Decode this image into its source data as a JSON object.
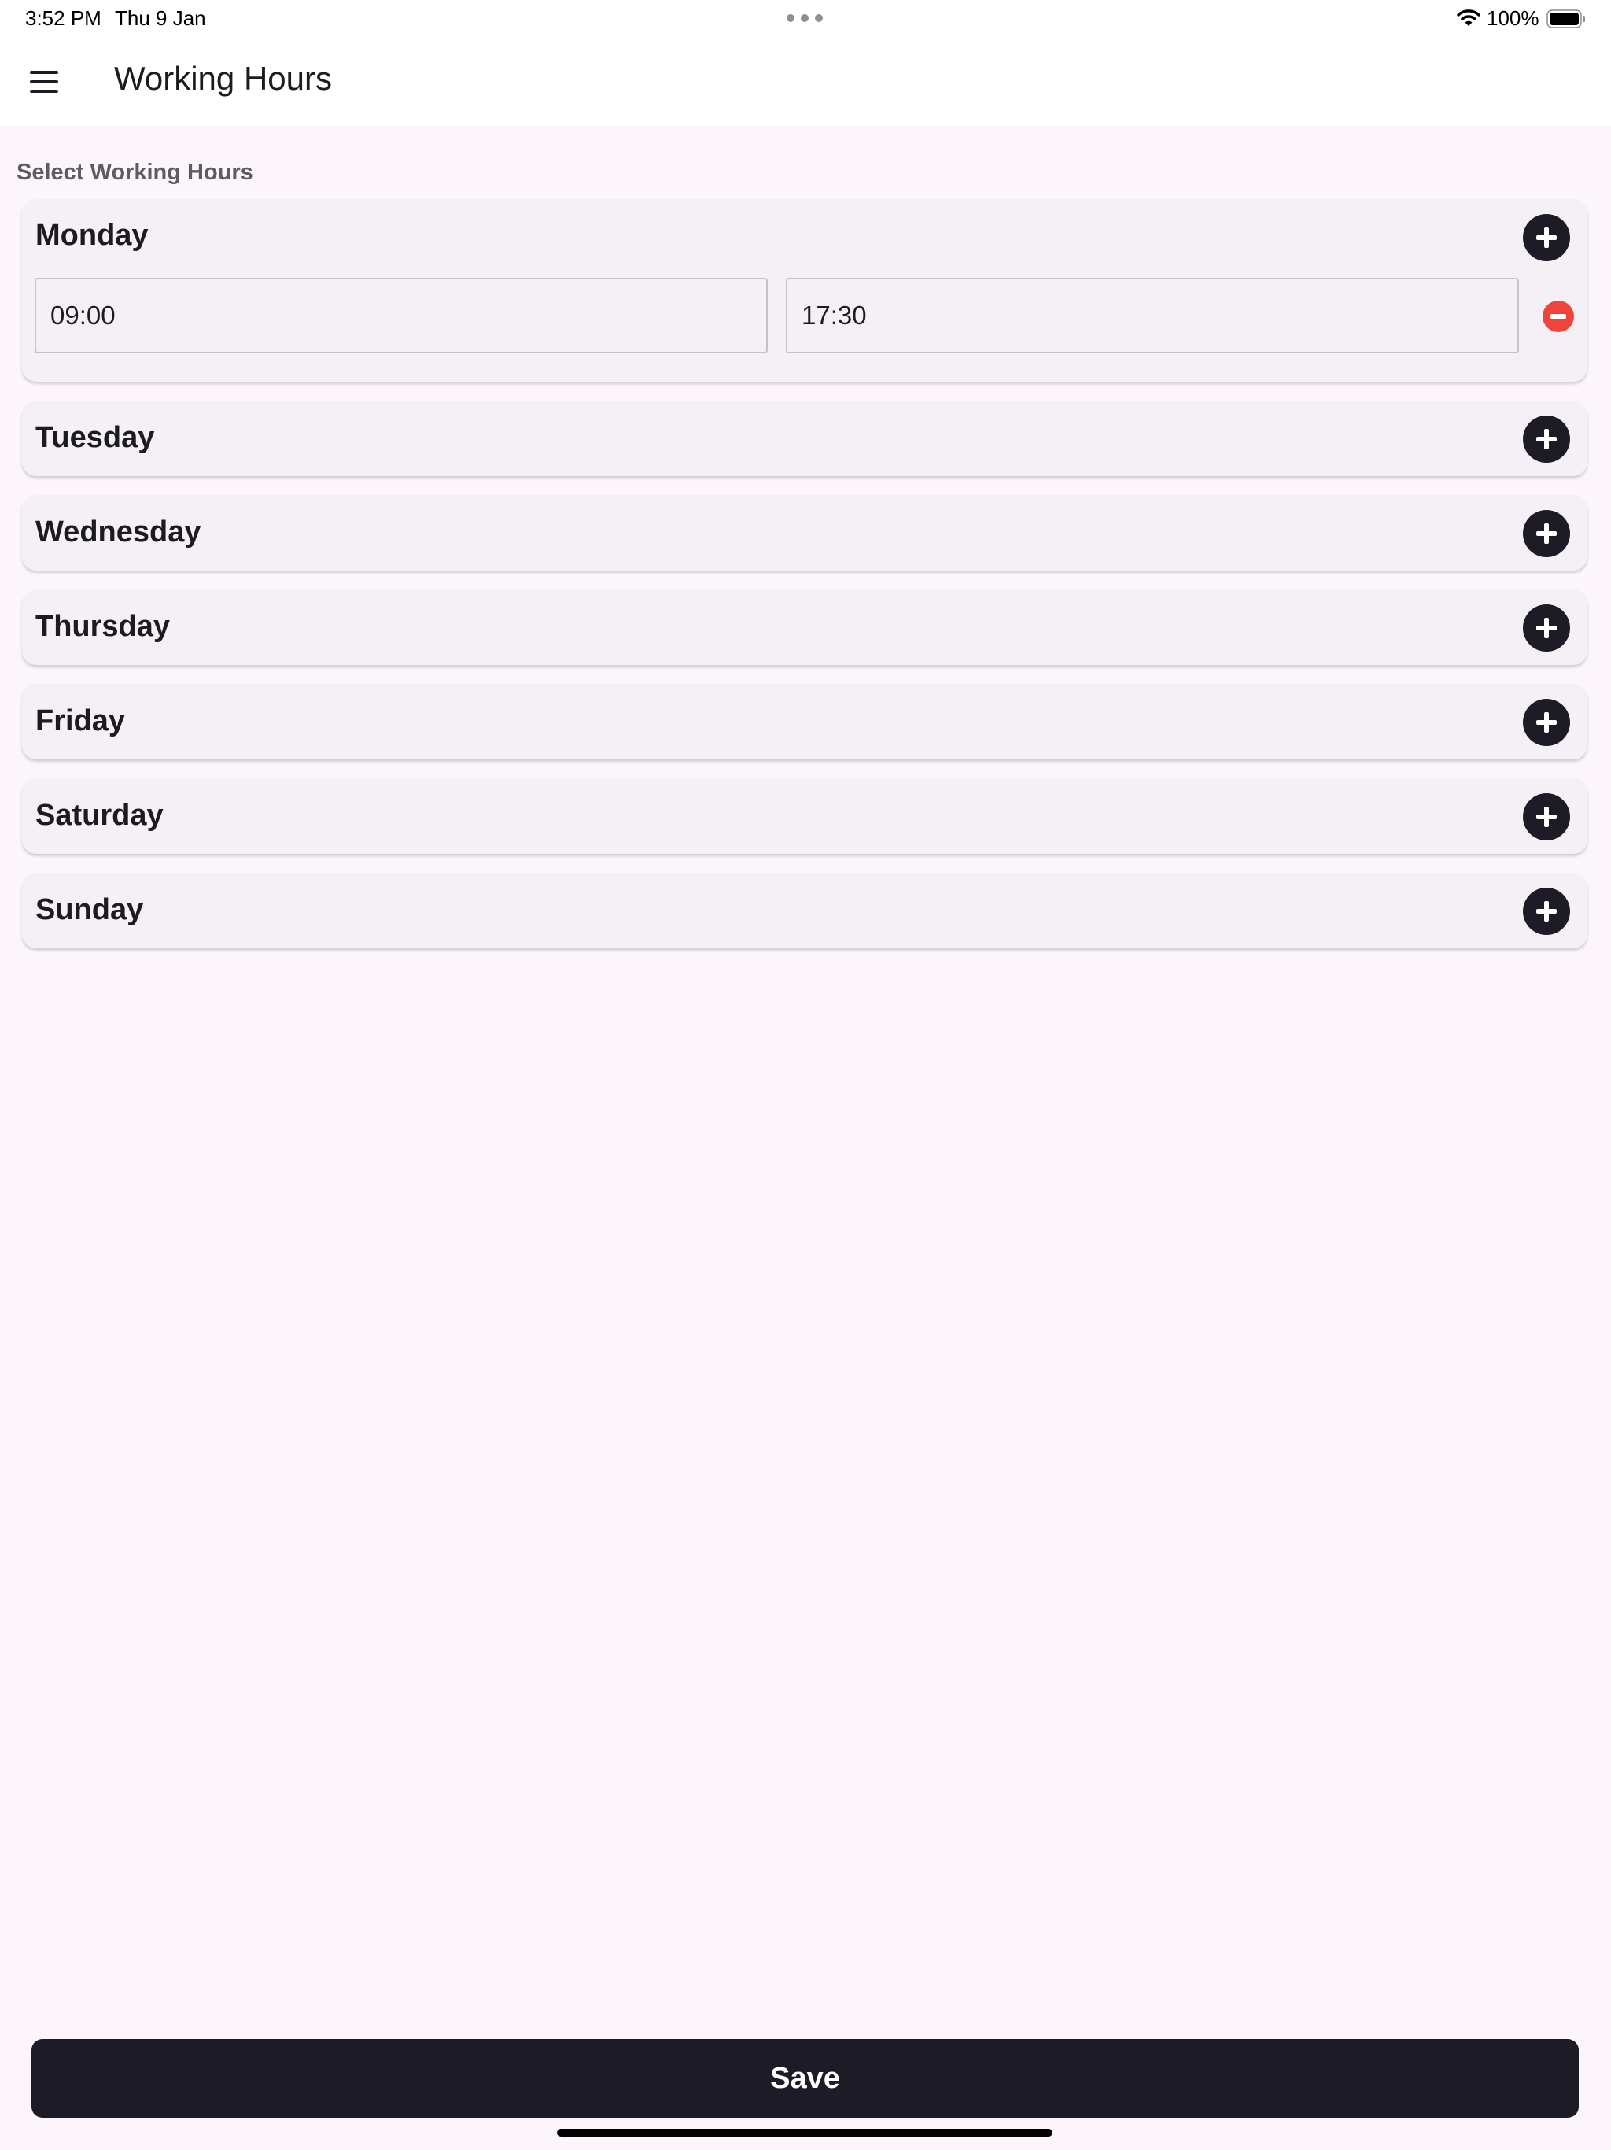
{
  "status_bar": {
    "time": "3:52 PM",
    "date": "Thu 9 Jan",
    "battery": "100%",
    "icons": [
      "more-dots-icon",
      "wifi-icon",
      "battery-icon"
    ]
  },
  "app_bar": {
    "title": "Working Hours",
    "menu_icon": "hamburger-menu-icon"
  },
  "section_label": "Select Working Hours",
  "days": [
    {
      "name": "Monday",
      "slots": [
        {
          "start": "09:00",
          "end": "17:30"
        }
      ]
    },
    {
      "name": "Tuesday",
      "slots": []
    },
    {
      "name": "Wednesday",
      "slots": []
    },
    {
      "name": "Thursday",
      "slots": []
    },
    {
      "name": "Friday",
      "slots": []
    },
    {
      "name": "Saturday",
      "slots": []
    },
    {
      "name": "Sunday",
      "slots": []
    }
  ],
  "icons": {
    "add": "add-circle-icon",
    "remove": "remove-circle-icon"
  },
  "save_label": "Save",
  "colors": {
    "background": "#fcf6fc",
    "card": "#f4f0f6",
    "primary": "#1c1b26",
    "danger": "#f0443a",
    "label": "#5f5b63"
  }
}
